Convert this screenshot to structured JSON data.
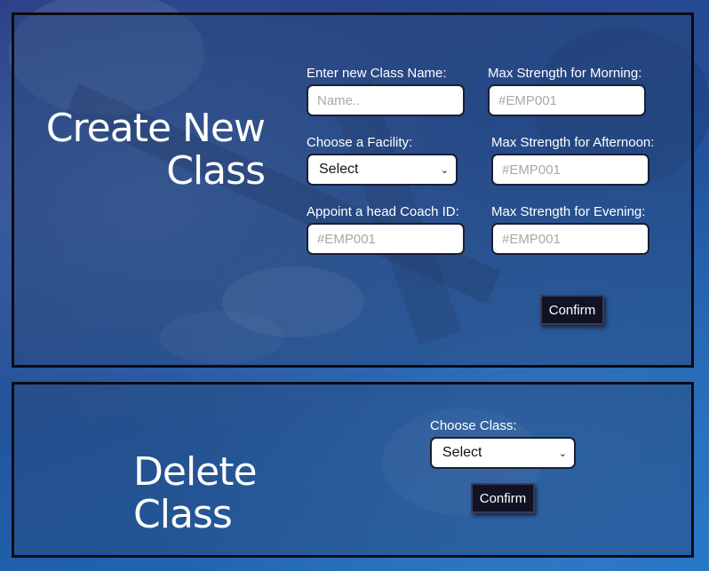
{
  "create_class": {
    "title": "Create New Class",
    "class_name": {
      "label": "Enter new Class Name:",
      "placeholder": "Name..",
      "value": ""
    },
    "facility": {
      "label": "Choose a Facility:",
      "selected": "Select"
    },
    "head_coach": {
      "label": "Appoint a head Coach ID:",
      "placeholder": "#EMP001",
      "value": ""
    },
    "max_morning": {
      "label": "Max Strength for Morning:",
      "placeholder": "#EMP001",
      "value": ""
    },
    "max_afternoon": {
      "label": "Max Strength for Afternoon:",
      "placeholder": "#EMP001",
      "value": ""
    },
    "max_evening": {
      "label": "Max Strength for Evening:",
      "placeholder": "#EMP001",
      "value": ""
    },
    "confirm_label": "Confirm"
  },
  "delete_class": {
    "title": "Delete Class",
    "choose_class": {
      "label": "Choose Class:",
      "selected": "Select"
    },
    "confirm_label": "Confirm"
  },
  "icons": {
    "dropdown": "chevron-down-icon"
  },
  "colors": {
    "panel_border": "#0b0b12",
    "button_bg": "#121225",
    "text": "#ffffff"
  }
}
